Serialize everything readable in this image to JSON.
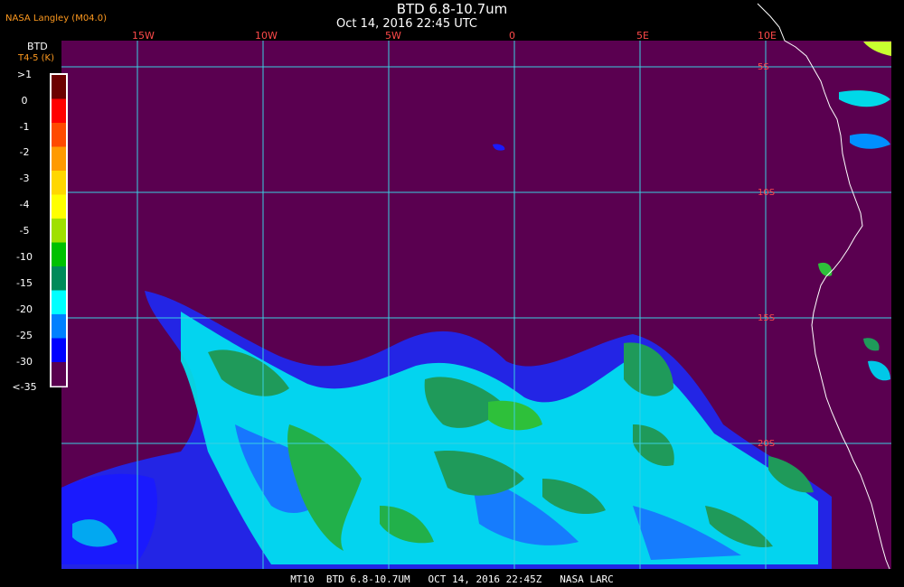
{
  "header": {
    "title": "BTD 6.8-10.7um",
    "subtitle": "Oct 14, 2016 22:45 UTC",
    "agency": "NASA Langley (M04.0)"
  },
  "colorbar": {
    "title": "BTD",
    "units": "T4-5 (K)",
    "labels": [
      ">1",
      "0",
      "-1",
      "-2",
      "-3",
      "-4",
      "-5",
      "-10",
      "-15",
      "-20",
      "-25",
      "-30",
      "<-35"
    ],
    "colors": [
      "#6b0000",
      "#ff0000",
      "#ff4a00",
      "#ff9a00",
      "#ffd700",
      "#ffff00",
      "#a0e000",
      "#00c000",
      "#008a5a",
      "#00ffff",
      "#0080ff",
      "#0000ff",
      "#5a0050"
    ]
  },
  "map": {
    "background": "#5a0050",
    "grid_color": "#3ad0e0",
    "coast_color": "#ffffff",
    "lon_labels": [
      "15W",
      "10W",
      "5W",
      "0",
      "5E",
      "10E"
    ],
    "lat_labels": [
      "5S",
      "10S",
      "15S",
      "20S"
    ]
  },
  "footer": {
    "text": "MT10  BTD 6.8-10.7UM   OCT 14, 2016 22:45Z   NASA LARC"
  }
}
